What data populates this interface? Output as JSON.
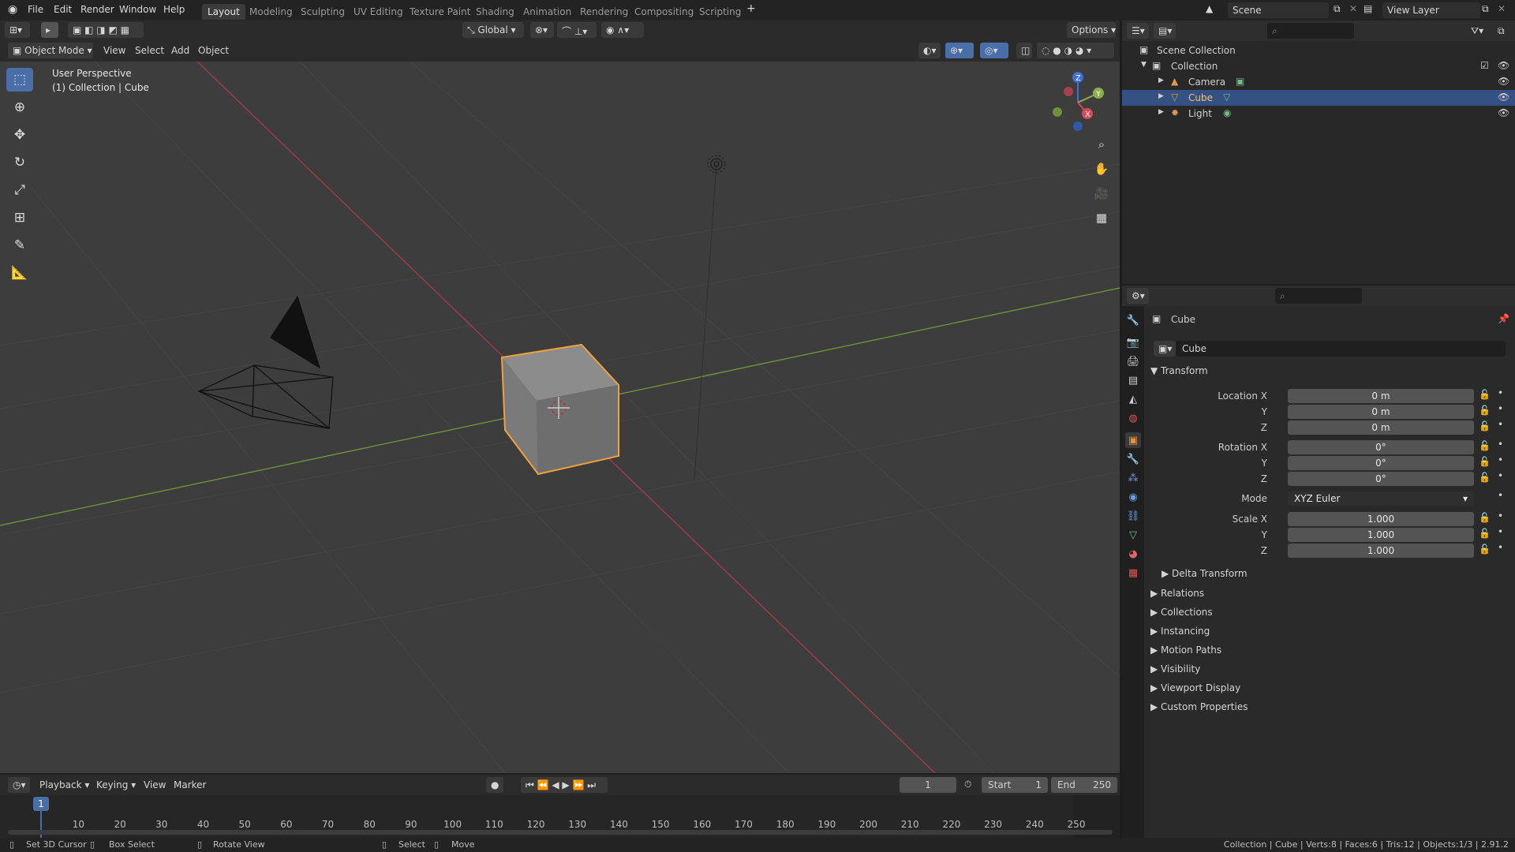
{
  "menu": {
    "file": "File",
    "edit": "Edit",
    "render": "Render",
    "window": "Window",
    "help": "Help"
  },
  "workspaces": [
    "Layout",
    "Modeling",
    "Sculpting",
    "UV Editing",
    "Texture Paint",
    "Shading",
    "Animation",
    "Rendering",
    "Compositing",
    "Scripting"
  ],
  "scene_name": "Scene",
  "view_layer": "View Layer",
  "viewport": {
    "mode": "Object Mode",
    "menus": [
      "View",
      "Select",
      "Add",
      "Object"
    ],
    "transform_orientation": "Global",
    "options": "Options",
    "overlay_line1": "User Perspective",
    "overlay_line2": "(1) Collection | Cube",
    "gizmo_axes": {
      "x": "X",
      "y": "Y",
      "z": "Z"
    }
  },
  "outliner": {
    "root": "Scene Collection",
    "collection": "Collection",
    "items": [
      {
        "name": "Camera",
        "selected": false
      },
      {
        "name": "Cube",
        "selected": true
      },
      {
        "name": "Light",
        "selected": false
      }
    ]
  },
  "properties": {
    "object_name": "Cube",
    "datablock": "Cube",
    "transform_title": "Transform",
    "location": {
      "label_x": "Location X",
      "label_y": "Y",
      "label_z": "Z",
      "x": "0 m",
      "y": "0 m",
      "z": "0 m"
    },
    "rotation": {
      "label_x": "Rotation X",
      "label_y": "Y",
      "label_z": "Z",
      "x": "0°",
      "y": "0°",
      "z": "0°"
    },
    "mode_label": "Mode",
    "mode_value": "XYZ Euler",
    "scale": {
      "label_x": "Scale X",
      "label_y": "Y",
      "label_z": "Z",
      "x": "1.000",
      "y": "1.000",
      "z": "1.000"
    },
    "subpanels": [
      "Delta Transform",
      "Relations",
      "Collections",
      "Instancing",
      "Motion Paths",
      "Visibility",
      "Viewport Display",
      "Custom Properties"
    ]
  },
  "timeline": {
    "menus": [
      "Playback",
      "Keying",
      "View",
      "Marker"
    ],
    "current_frame": "1",
    "start_label": "Start",
    "start_value": "1",
    "end_label": "End",
    "end_value": "250",
    "ticks": [
      "1",
      "10",
      "20",
      "30",
      "40",
      "50",
      "60",
      "70",
      "80",
      "90",
      "100",
      "110",
      "120",
      "130",
      "140",
      "150",
      "160",
      "170",
      "180",
      "190",
      "200",
      "210",
      "220",
      "230",
      "240",
      "250"
    ]
  },
  "status": {
    "set_cursor": "Set 3D Cursor",
    "box_select": "Box Select",
    "rotate_view": "Rotate View",
    "select": "Select",
    "move": "Move",
    "stats": "Collection | Cube | Verts:8 | Faces:6 | Tris:12 | Objects:1/3 | 2.91.2"
  }
}
